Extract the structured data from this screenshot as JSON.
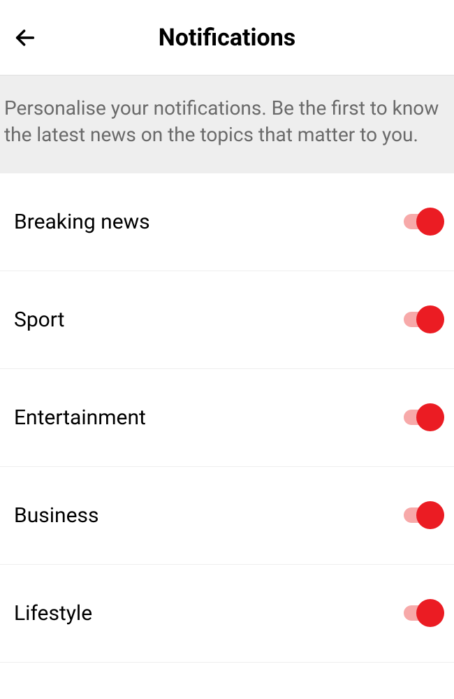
{
  "header": {
    "title": "Notifications"
  },
  "description": "Personalise your notifications. Be the first to know the latest news on the topics that matter to you.",
  "items": [
    {
      "label": "Breaking news",
      "enabled": true
    },
    {
      "label": "Sport",
      "enabled": true
    },
    {
      "label": "Entertainment",
      "enabled": true
    },
    {
      "label": "Business",
      "enabled": true
    },
    {
      "label": "Lifestyle",
      "enabled": true
    }
  ],
  "colors": {
    "accent": "#eb1c23",
    "track": "#f7a9a9"
  }
}
